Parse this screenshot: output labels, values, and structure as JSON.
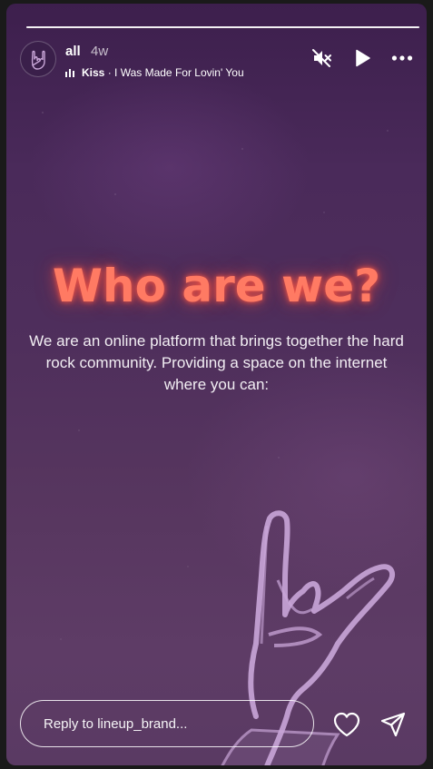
{
  "story": {
    "progress": 1.0,
    "header": {
      "username": "all",
      "timestamp": "4w",
      "music": {
        "artist": "Kiss",
        "separator": " · ",
        "track": "I Was Made For Lovin' You"
      },
      "controls": [
        "mute-icon",
        "play-icon",
        "more-icon"
      ]
    },
    "content": {
      "title": "Who are we?",
      "body": "We are an online platform that brings together the hard rock community. Providing a space on the internet where you can:"
    },
    "footer": {
      "reply_placeholder": "Reply to lineup_brand...",
      "actions": [
        "heart-icon",
        "send-icon"
      ]
    }
  },
  "colors": {
    "title_glow": "#ff7a63",
    "background_top": "#3d1f4d",
    "background_bottom": "#5e3c66",
    "hand_stroke": "#c9a6d8"
  }
}
